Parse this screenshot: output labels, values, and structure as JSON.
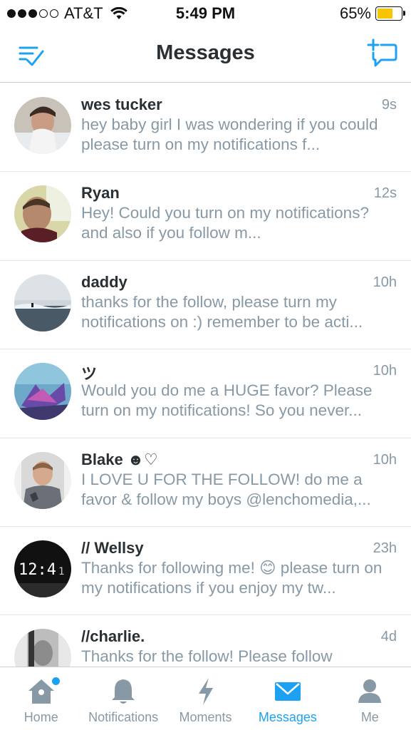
{
  "status_bar": {
    "carrier": "AT&T",
    "time": "5:49 PM",
    "battery": "65%",
    "battery_level": 0.65
  },
  "nav": {
    "title": "Messages",
    "left_icon": "compose-list-check-icon",
    "right_icon": "new-message-icon"
  },
  "messages": [
    {
      "name": "wes tucker",
      "time": "9s",
      "preview": "hey baby girl I was wondering if you could please turn on my notifications f..."
    },
    {
      "name": "Ryan",
      "time": "12s",
      "preview": "Hey! Could you turn on my notifications? and also if you follow m..."
    },
    {
      "name": "daddy",
      "time": "10h",
      "preview": "thanks for the follow, please turn my notifications on :) remember to be acti..."
    },
    {
      "name": "ツ",
      "time": "10h",
      "preview": "Would you do me a HUGE favor? Please turn on my notifications! So you never..."
    },
    {
      "name": "Blake ☻♡",
      "time": "10h",
      "preview": "I LOVE U FOR THE FOLLOW! do me a favor & follow my boys @lenchomedia,..."
    },
    {
      "name": "// Wellsy",
      "time": "23h",
      "preview": "Thanks for following me! 😊 please turn on my notifications if you enjoy my tw..."
    },
    {
      "name": "//charlie.",
      "time": "4d",
      "preview": "Thanks for the follow! Please follow"
    }
  ],
  "tabs": [
    {
      "label": "Home",
      "icon": "home-icon",
      "has_badge": true
    },
    {
      "label": "Notifications",
      "icon": "bell-icon"
    },
    {
      "label": "Moments",
      "icon": "lightning-icon"
    },
    {
      "label": "Messages",
      "icon": "envelope-icon",
      "active": true
    },
    {
      "label": "Me",
      "icon": "person-icon"
    }
  ],
  "colors": {
    "accent": "#1da1f2",
    "inactive": "#8899a6",
    "text": "#292f33",
    "battery": "#f6c400"
  }
}
